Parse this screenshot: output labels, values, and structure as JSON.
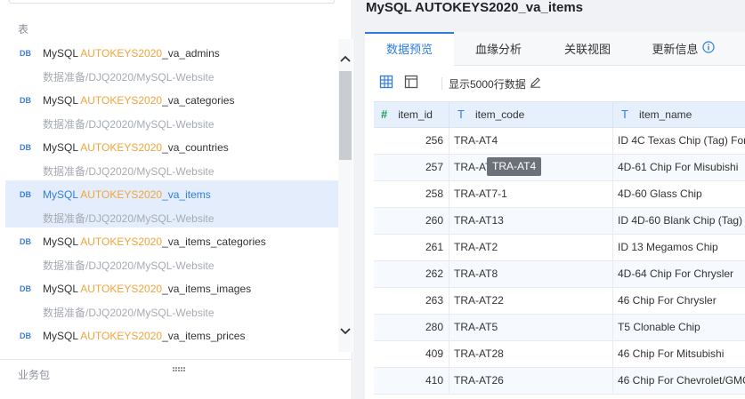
{
  "left_panel": {
    "section_tables_label": "表",
    "section_business_label": "业务包",
    "tables": [
      {
        "icon": "DB",
        "prefix": "MySQL ",
        "highlight": "AUTOKEYS2020",
        "suffix": "_va_admins",
        "path": "数据准备/DJQ2020/MySQL-Website",
        "active": false
      },
      {
        "icon": "DB",
        "prefix": "MySQL ",
        "highlight": "AUTOKEYS2020",
        "suffix": "_va_categories",
        "path": "数据准备/DJQ2020/MySQL-Website",
        "active": false
      },
      {
        "icon": "DB",
        "prefix": "MySQL ",
        "highlight": "AUTOKEYS2020",
        "suffix": "_va_countries",
        "path": "数据准备/DJQ2020/MySQL-Website",
        "active": false
      },
      {
        "icon": "DB",
        "prefix": "MySQL ",
        "highlight": "AUTOKEYS2020",
        "suffix": "_va_items",
        "path": "数据准备/DJQ2020/MySQL-Website",
        "active": true
      },
      {
        "icon": "DB",
        "prefix": "MySQL ",
        "highlight": "AUTOKEYS2020",
        "suffix": "_va_items_categories",
        "path": "数据准备/DJQ2020/MySQL-Website",
        "active": false
      },
      {
        "icon": "DB",
        "prefix": "MySQL ",
        "highlight": "AUTOKEYS2020",
        "suffix": "_va_items_images",
        "path": "数据准备/DJQ2020/MySQL-Website",
        "active": false
      },
      {
        "icon": "DB",
        "prefix": "MySQL ",
        "highlight": "AUTOKEYS2020",
        "suffix": "_va_items_prices",
        "path": "",
        "active": false
      }
    ]
  },
  "main": {
    "title": "MySQL AUTOKEYS2020_va_items",
    "tabs": [
      {
        "label": "数据预览",
        "active": true
      },
      {
        "label": "血缘分析",
        "active": false
      },
      {
        "label": "关联视图",
        "active": false
      },
      {
        "label": "更新信息",
        "active": false
      }
    ],
    "toolbar": {
      "show_rows_label": "显示5000行数据"
    },
    "grid": {
      "columns": [
        {
          "type_icon": "#",
          "label": "item_id"
        },
        {
          "type_icon": "T",
          "label": "item_code"
        },
        {
          "type_icon": "T",
          "label": "item_name"
        }
      ],
      "rows": [
        [
          "256",
          "TRA-AT4",
          "ID 4C Texas Chip (Tag) For"
        ],
        [
          "257",
          "TRA-AT1",
          "4D-61 Chip For Misubishi"
        ],
        [
          "258",
          "TRA-AT7-1",
          "4D-60 Glass Chip"
        ],
        [
          "260",
          "TRA-AT13",
          "ID 4D-60 Blank Chip (Tag)"
        ],
        [
          "261",
          "TRA-AT2",
          "ID 13 Megamos Chip"
        ],
        [
          "262",
          "TRA-AT8",
          "4D-64 Chip For Chrysler"
        ],
        [
          "263",
          "TRA-AT22",
          "46 Chip For Chrysler"
        ],
        [
          "280",
          "TRA-AT5",
          "T5 Clonable Chip"
        ],
        [
          "409",
          "TRA-AT28",
          "46 Chip For Mitsubishi"
        ],
        [
          "410",
          "TRA-AT26",
          "46 Chip For Chevrolet/GMC"
        ]
      ]
    },
    "tooltip": "TRA-AT4"
  },
  "colors": {
    "accent": "#2f7de1",
    "highlight": "#f2a43a",
    "active_row_bg": "#e3edfb",
    "header_bg": "#e6f0fc"
  }
}
